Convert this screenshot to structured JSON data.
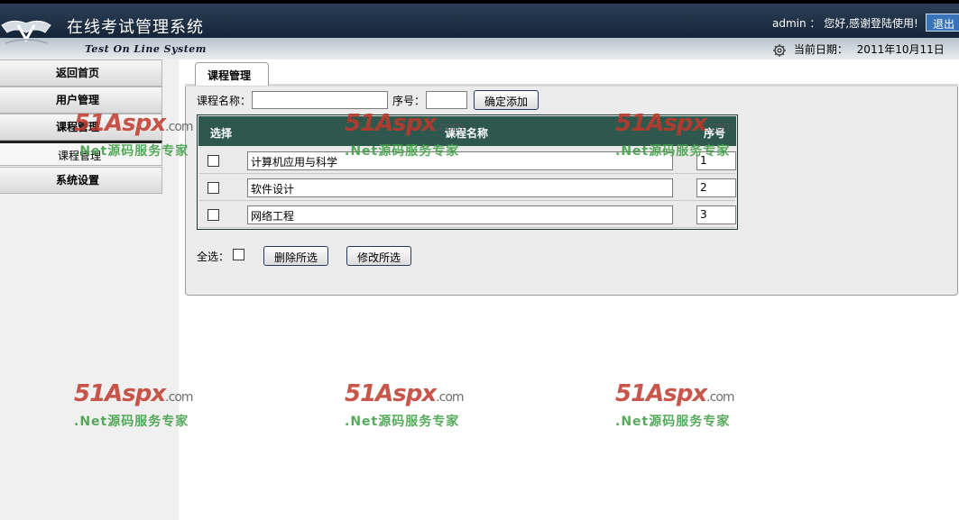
{
  "header": {
    "app_title": "在线考试管理系统",
    "app_subtitle": "Test On Line System",
    "welcome": "admin ： 您好,感谢登陆使用!",
    "logout_label": "退出",
    "date_label": "当前日期：",
    "date_value": "2011年10月11日"
  },
  "sidebar": {
    "items": [
      {
        "label": "返回首页"
      },
      {
        "label": "用户管理"
      },
      {
        "label": "课程管理"
      },
      {
        "label": "课程管理"
      },
      {
        "label": "系统设置"
      }
    ]
  },
  "main": {
    "tab_label": "课程管理",
    "form": {
      "name_label": "课程名称：",
      "name_value": "",
      "order_label": "序号：",
      "order_value": "",
      "add_button": "确定添加"
    },
    "table": {
      "headers": [
        "选择",
        "课程名称",
        "序号"
      ],
      "rows": [
        {
          "name": "计算机应用与科学",
          "order": "1"
        },
        {
          "name": "软件设计",
          "order": "2"
        },
        {
          "name": "网络工程",
          "order": "3"
        }
      ]
    },
    "select_all_label": "全选：",
    "delete_button": "删除所选",
    "edit_button": "修改所选"
  },
  "watermark": {
    "logo_main": "51Aspx",
    "logo_suffix": ".com",
    "tagline": ".Net源码服务专家"
  },
  "colors": {
    "header_dark": "#152538",
    "table_header": "#2e584e",
    "logout_blue": "#3a74b8"
  }
}
